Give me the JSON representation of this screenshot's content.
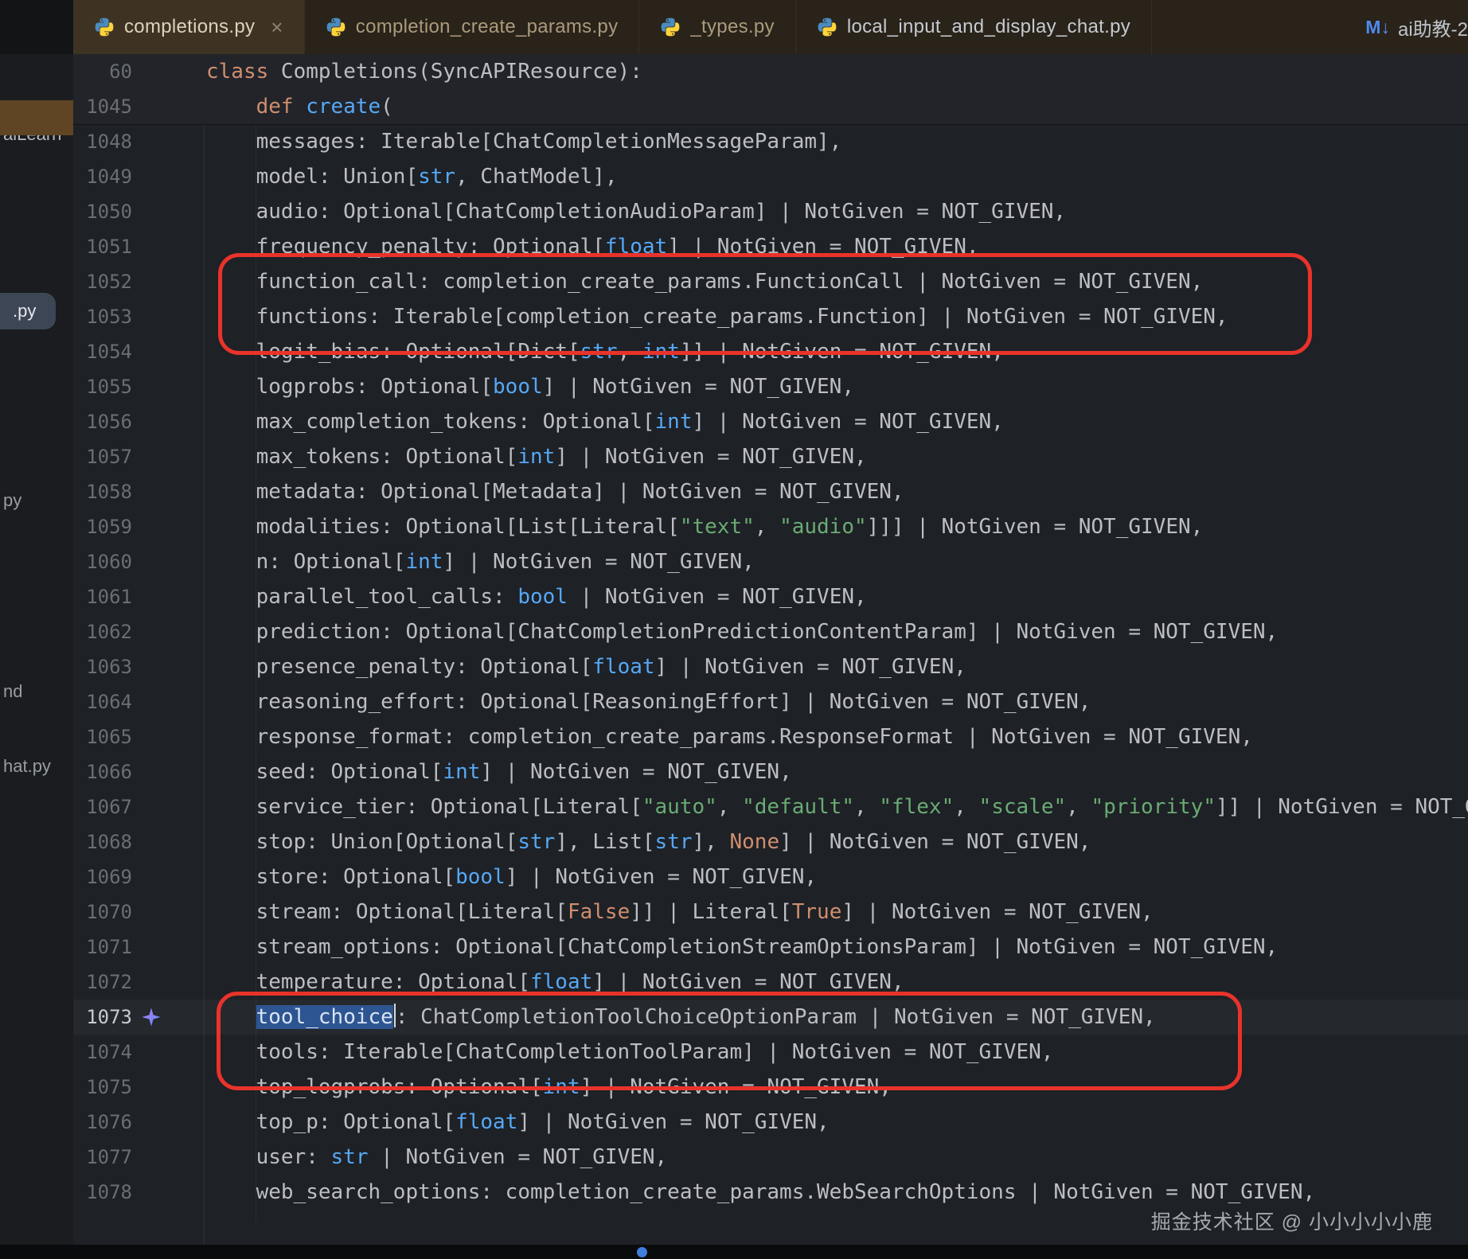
{
  "sidebar": {
    "items": [
      {
        "label": "aiLearn"
      },
      {
        "label": ".py"
      },
      {
        "label": "py"
      },
      {
        "label": "nd"
      },
      {
        "label": "hat.py"
      }
    ]
  },
  "tabs": [
    {
      "label": "completions.py",
      "close": "×"
    },
    {
      "label": "completion_create_params.py"
    },
    {
      "label": "_types.py"
    },
    {
      "label": "local_input_and_display_chat.py"
    }
  ],
  "right_tab": {
    "icon": "M↓",
    "label": "ai助教-2"
  },
  "footer": {
    "watermark": "掘金技术社区 @ 小小小小小鹿"
  },
  "colors": {
    "annotation_red": "#e8332b",
    "selection_blue": "#2d5591",
    "keyword_orange": "#cf8e6d",
    "builtin_blue": "#56a8f5",
    "string_green": "#6aab73",
    "editor_bg": "#1e2126",
    "active_tab_bg": "#3e3323"
  },
  "editor": {
    "lines": [
      {
        "num": "60",
        "sticky": true,
        "tokens": [
          {
            "t": "class ",
            "c": "k"
          },
          {
            "t": "Completions(SyncAPIResource):",
            "c": "d"
          }
        ]
      },
      {
        "num": "1045",
        "sticky": true,
        "sticky_last": true,
        "tokens": [
          {
            "t": "    ",
            "c": "d"
          },
          {
            "t": "def ",
            "c": "k"
          },
          {
            "t": "create",
            "c": "f"
          },
          {
            "t": "(",
            "c": "d"
          }
        ]
      },
      {
        "num": "1048",
        "tokens": [
          {
            "t": "    messages: Iterable[ChatCompletionMessageParam],",
            "c": "d"
          }
        ]
      },
      {
        "num": "1049",
        "tokens": [
          {
            "t": "    model: Union[",
            "c": "d"
          },
          {
            "t": "str",
            "c": "b"
          },
          {
            "t": ", ChatModel],",
            "c": "d"
          }
        ]
      },
      {
        "num": "1050",
        "tokens": [
          {
            "t": "    audio: Optional[ChatCompletionAudioParam] | NotGiven = NOT_GIVEN,",
            "c": "d"
          }
        ]
      },
      {
        "num": "1051",
        "tokens": [
          {
            "t": "    frequency_penalty: Optional[",
            "c": "d"
          },
          {
            "t": "float",
            "c": "b"
          },
          {
            "t": "] | NotGiven = NOT_GIVEN,",
            "c": "d"
          }
        ]
      },
      {
        "num": "1052",
        "tokens": [
          {
            "t": "    function_call: completion_create_params.FunctionCall | NotGiven = NOT_GIVEN,",
            "c": "d"
          }
        ]
      },
      {
        "num": "1053",
        "tokens": [
          {
            "t": "    functions: Iterable[completion_create_params.Function] | NotGiven = NOT_GIVEN,",
            "c": "d"
          }
        ]
      },
      {
        "num": "1054",
        "tokens": [
          {
            "t": "    logit_bias: Optional[Dict[",
            "c": "d"
          },
          {
            "t": "str",
            "c": "b"
          },
          {
            "t": ", ",
            "c": "d"
          },
          {
            "t": "int",
            "c": "b"
          },
          {
            "t": "]] | NotGiven = NOT_GIVEN,",
            "c": "d"
          }
        ]
      },
      {
        "num": "1055",
        "tokens": [
          {
            "t": "    logprobs: Optional[",
            "c": "d"
          },
          {
            "t": "bool",
            "c": "b"
          },
          {
            "t": "] | NotGiven = NOT_GIVEN,",
            "c": "d"
          }
        ]
      },
      {
        "num": "1056",
        "tokens": [
          {
            "t": "    max_completion_tokens: Optional[",
            "c": "d"
          },
          {
            "t": "int",
            "c": "b"
          },
          {
            "t": "] | NotGiven = NOT_GIVEN,",
            "c": "d"
          }
        ]
      },
      {
        "num": "1057",
        "tokens": [
          {
            "t": "    max_tokens: Optional[",
            "c": "d"
          },
          {
            "t": "int",
            "c": "b"
          },
          {
            "t": "] | NotGiven = NOT_GIVEN,",
            "c": "d"
          }
        ]
      },
      {
        "num": "1058",
        "tokens": [
          {
            "t": "    metadata: Optional[Metadata] | NotGiven = NOT_GIVEN,",
            "c": "d"
          }
        ]
      },
      {
        "num": "1059",
        "tokens": [
          {
            "t": "    modalities: Optional[List[Literal[",
            "c": "d"
          },
          {
            "t": "\"text\"",
            "c": "s"
          },
          {
            "t": ", ",
            "c": "d"
          },
          {
            "t": "\"audio\"",
            "c": "s"
          },
          {
            "t": "]]] | NotGiven = NOT_GIVEN,",
            "c": "d"
          }
        ]
      },
      {
        "num": "1060",
        "tokens": [
          {
            "t": "    n: Optional[",
            "c": "d"
          },
          {
            "t": "int",
            "c": "b"
          },
          {
            "t": "] | NotGiven = NOT_GIVEN,",
            "c": "d"
          }
        ]
      },
      {
        "num": "1061",
        "tokens": [
          {
            "t": "    parallel_tool_calls: ",
            "c": "d"
          },
          {
            "t": "bool",
            "c": "b"
          },
          {
            "t": " | NotGiven = NOT_GIVEN,",
            "c": "d"
          }
        ]
      },
      {
        "num": "1062",
        "tokens": [
          {
            "t": "    prediction: Optional[ChatCompletionPredictionContentParam] | NotGiven = NOT_GIVEN,",
            "c": "d"
          }
        ]
      },
      {
        "num": "1063",
        "tokens": [
          {
            "t": "    presence_penalty: Optional[",
            "c": "d"
          },
          {
            "t": "float",
            "c": "b"
          },
          {
            "t": "] | NotGiven = NOT_GIVEN,",
            "c": "d"
          }
        ]
      },
      {
        "num": "1064",
        "tokens": [
          {
            "t": "    reasoning_effort: Optional[ReasoningEffort] | NotGiven = NOT_GIVEN,",
            "c": "d"
          }
        ]
      },
      {
        "num": "1065",
        "tokens": [
          {
            "t": "    response_format: completion_create_params.ResponseFormat | NotGiven = NOT_GIVEN,",
            "c": "d"
          }
        ]
      },
      {
        "num": "1066",
        "tokens": [
          {
            "t": "    seed: Optional[",
            "c": "d"
          },
          {
            "t": "int",
            "c": "b"
          },
          {
            "t": "] | NotGiven = NOT_GIVEN,",
            "c": "d"
          }
        ]
      },
      {
        "num": "1067",
        "tokens": [
          {
            "t": "    service_tier: Optional[Literal[",
            "c": "d"
          },
          {
            "t": "\"auto\"",
            "c": "s"
          },
          {
            "t": ", ",
            "c": "d"
          },
          {
            "t": "\"default\"",
            "c": "s"
          },
          {
            "t": ", ",
            "c": "d"
          },
          {
            "t": "\"flex\"",
            "c": "s"
          },
          {
            "t": ", ",
            "c": "d"
          },
          {
            "t": "\"scale\"",
            "c": "s"
          },
          {
            "t": ", ",
            "c": "d"
          },
          {
            "t": "\"priority\"",
            "c": "s"
          },
          {
            "t": "]] | NotGiven = NOT_GIVEN,",
            "c": "d"
          }
        ]
      },
      {
        "num": "1068",
        "tokens": [
          {
            "t": "    stop: Union[Optional[",
            "c": "d"
          },
          {
            "t": "str",
            "c": "b"
          },
          {
            "t": "], List[",
            "c": "d"
          },
          {
            "t": "str",
            "c": "b"
          },
          {
            "t": "], ",
            "c": "d"
          },
          {
            "t": "None",
            "c": "k"
          },
          {
            "t": "] | NotGiven = NOT_GIVEN,",
            "c": "d"
          }
        ]
      },
      {
        "num": "1069",
        "tokens": [
          {
            "t": "    store: Optional[",
            "c": "d"
          },
          {
            "t": "bool",
            "c": "b"
          },
          {
            "t": "] | NotGiven = NOT_GIVEN,",
            "c": "d"
          }
        ]
      },
      {
        "num": "1070",
        "tokens": [
          {
            "t": "    stream: Optional[Literal[",
            "c": "d"
          },
          {
            "t": "False",
            "c": "k"
          },
          {
            "t": "]] | Literal[",
            "c": "d"
          },
          {
            "t": "True",
            "c": "k"
          },
          {
            "t": "] | NotGiven = NOT_GIVEN,",
            "c": "d"
          }
        ]
      },
      {
        "num": "1071",
        "tokens": [
          {
            "t": "    stream_options: Optional[ChatCompletionStreamOptionsParam] | NotGiven = NOT_GIVEN,",
            "c": "d"
          }
        ]
      },
      {
        "num": "1072",
        "tokens": [
          {
            "t": "    temperature: Optional[",
            "c": "d"
          },
          {
            "t": "float",
            "c": "b"
          },
          {
            "t": "] | NotGiven = NOT_GIVEN,",
            "c": "d"
          }
        ]
      },
      {
        "num": "1073",
        "current": true,
        "ai_icon": true,
        "tokens": [
          {
            "t": "    ",
            "c": "d"
          },
          {
            "t": "tool_choice",
            "c": "sel"
          },
          {
            "t": ": ChatCompletionToolChoiceOptionParam | NotGiven = NOT_GIVEN,",
            "c": "d"
          }
        ]
      },
      {
        "num": "1074",
        "tokens": [
          {
            "t": "    tools: Iterable[ChatCompletionToolParam] | NotGiven = NOT_GIVEN,",
            "c": "d"
          }
        ]
      },
      {
        "num": "1075",
        "tokens": [
          {
            "t": "    top_logprobs: Optional[",
            "c": "d"
          },
          {
            "t": "int",
            "c": "b"
          },
          {
            "t": "] | NotGiven = NOT_GIVEN,",
            "c": "d"
          }
        ]
      },
      {
        "num": "1076",
        "tokens": [
          {
            "t": "    top_p: Optional[",
            "c": "d"
          },
          {
            "t": "float",
            "c": "b"
          },
          {
            "t": "] | NotGiven = NOT_GIVEN,",
            "c": "d"
          }
        ]
      },
      {
        "num": "1077",
        "tokens": [
          {
            "t": "    user: ",
            "c": "d"
          },
          {
            "t": "str",
            "c": "b"
          },
          {
            "t": " | NotGiven = NOT_GIVEN,",
            "c": "d"
          }
        ]
      },
      {
        "num": "1078",
        "tokens": [
          {
            "t": "    web_search_options: completion_create_params.WebSearchOptions | NotGiven = NOT_GIVEN,",
            "c": "d"
          }
        ]
      }
    ]
  }
}
